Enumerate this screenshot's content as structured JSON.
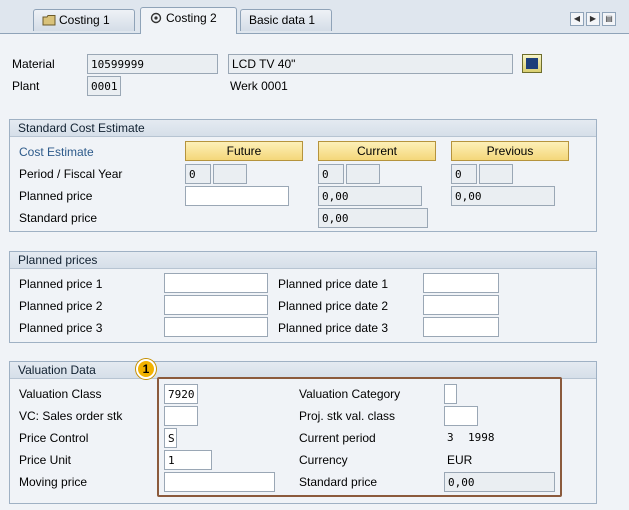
{
  "tabs": [
    {
      "label": "Costing 1"
    },
    {
      "label": "Costing 2"
    },
    {
      "label": "Basic data 1"
    }
  ],
  "header": {
    "material_label": "Material",
    "material_value": "10599999",
    "material_desc": "LCD TV 40\"",
    "plant_label": "Plant",
    "plant_value": "0001",
    "plant_desc": "Werk 0001"
  },
  "standard_cost": {
    "title": "Standard Cost Estimate",
    "cost_estimate_label": "Cost Estimate",
    "future_btn": "Future",
    "current_btn": "Current",
    "previous_btn": "Previous",
    "period_label": "Period / Fiscal Year",
    "future_period": "0",
    "current_period": "0",
    "previous_period": "0",
    "planned_price_label": "Planned price",
    "current_planned": "0,00",
    "previous_planned": "0,00",
    "standard_price_label": "Standard price",
    "current_standard": "0,00"
  },
  "planned_prices": {
    "title": "Planned prices",
    "price1_label": "Planned price 1",
    "price2_label": "Planned price 2",
    "price3_label": "Planned price 3",
    "date1_label": "Planned price date 1",
    "date2_label": "Planned price date 2",
    "date3_label": "Planned price date 3"
  },
  "valuation": {
    "title": "Valuation Data",
    "badge": "1",
    "val_class_label": "Valuation Class",
    "val_class_value": "7920",
    "vc_sales_label": "VC: Sales order stk",
    "price_control_label": "Price Control",
    "price_control_value": "S",
    "price_unit_label": "Price Unit",
    "price_unit_value": "1",
    "moving_price_label": "Moving price",
    "val_category_label": "Valuation Category",
    "proj_stk_label": "Proj. stk val. class",
    "current_period_label": "Current period",
    "current_period_value": "3",
    "current_year_value": "1998",
    "currency_label": "Currency",
    "currency_value": "EUR",
    "standard_price_label": "Standard price",
    "standard_price_value": "0,00"
  }
}
